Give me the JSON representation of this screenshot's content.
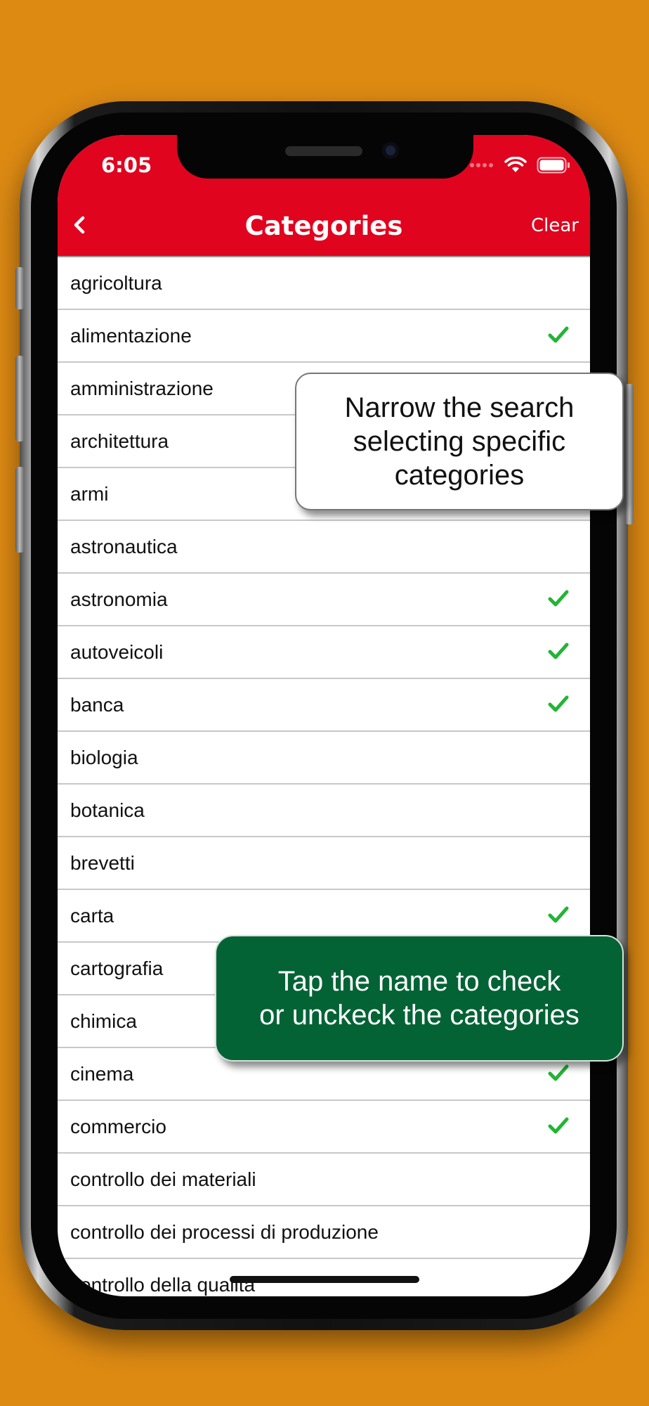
{
  "status_bar": {
    "time": "6:05"
  },
  "nav": {
    "title": "Categories",
    "clear_label": "Clear",
    "back_icon": "chevron-left-icon"
  },
  "categories": [
    {
      "label": "agricoltura",
      "checked": false
    },
    {
      "label": "alimentazione",
      "checked": true
    },
    {
      "label": "amministrazione",
      "checked": false
    },
    {
      "label": "architettura",
      "checked": false
    },
    {
      "label": "armi",
      "checked": false
    },
    {
      "label": "astronautica",
      "checked": false
    },
    {
      "label": "astronomia",
      "checked": true
    },
    {
      "label": "autoveicoli",
      "checked": true
    },
    {
      "label": "banca",
      "checked": true
    },
    {
      "label": "biologia",
      "checked": false
    },
    {
      "label": "botanica",
      "checked": false
    },
    {
      "label": "brevetti",
      "checked": false
    },
    {
      "label": "carta",
      "checked": true
    },
    {
      "label": "cartografia",
      "checked": false
    },
    {
      "label": "chimica",
      "checked": false
    },
    {
      "label": "cinema",
      "checked": true
    },
    {
      "label": "commercio",
      "checked": true
    },
    {
      "label": "controllo dei materiali",
      "checked": false
    },
    {
      "label": "controllo dei processi di produzione",
      "checked": false
    },
    {
      "label": "controllo della qualità",
      "checked": false
    }
  ],
  "callouts": {
    "top": "Narrow the search\nselecting specific\ncategories",
    "bottom": "Tap the name to check\nor unckeck the categories"
  },
  "colors": {
    "header": "#e0041f",
    "check": "#22b534",
    "background": "#dd8a13",
    "callout_green": "#046335"
  }
}
